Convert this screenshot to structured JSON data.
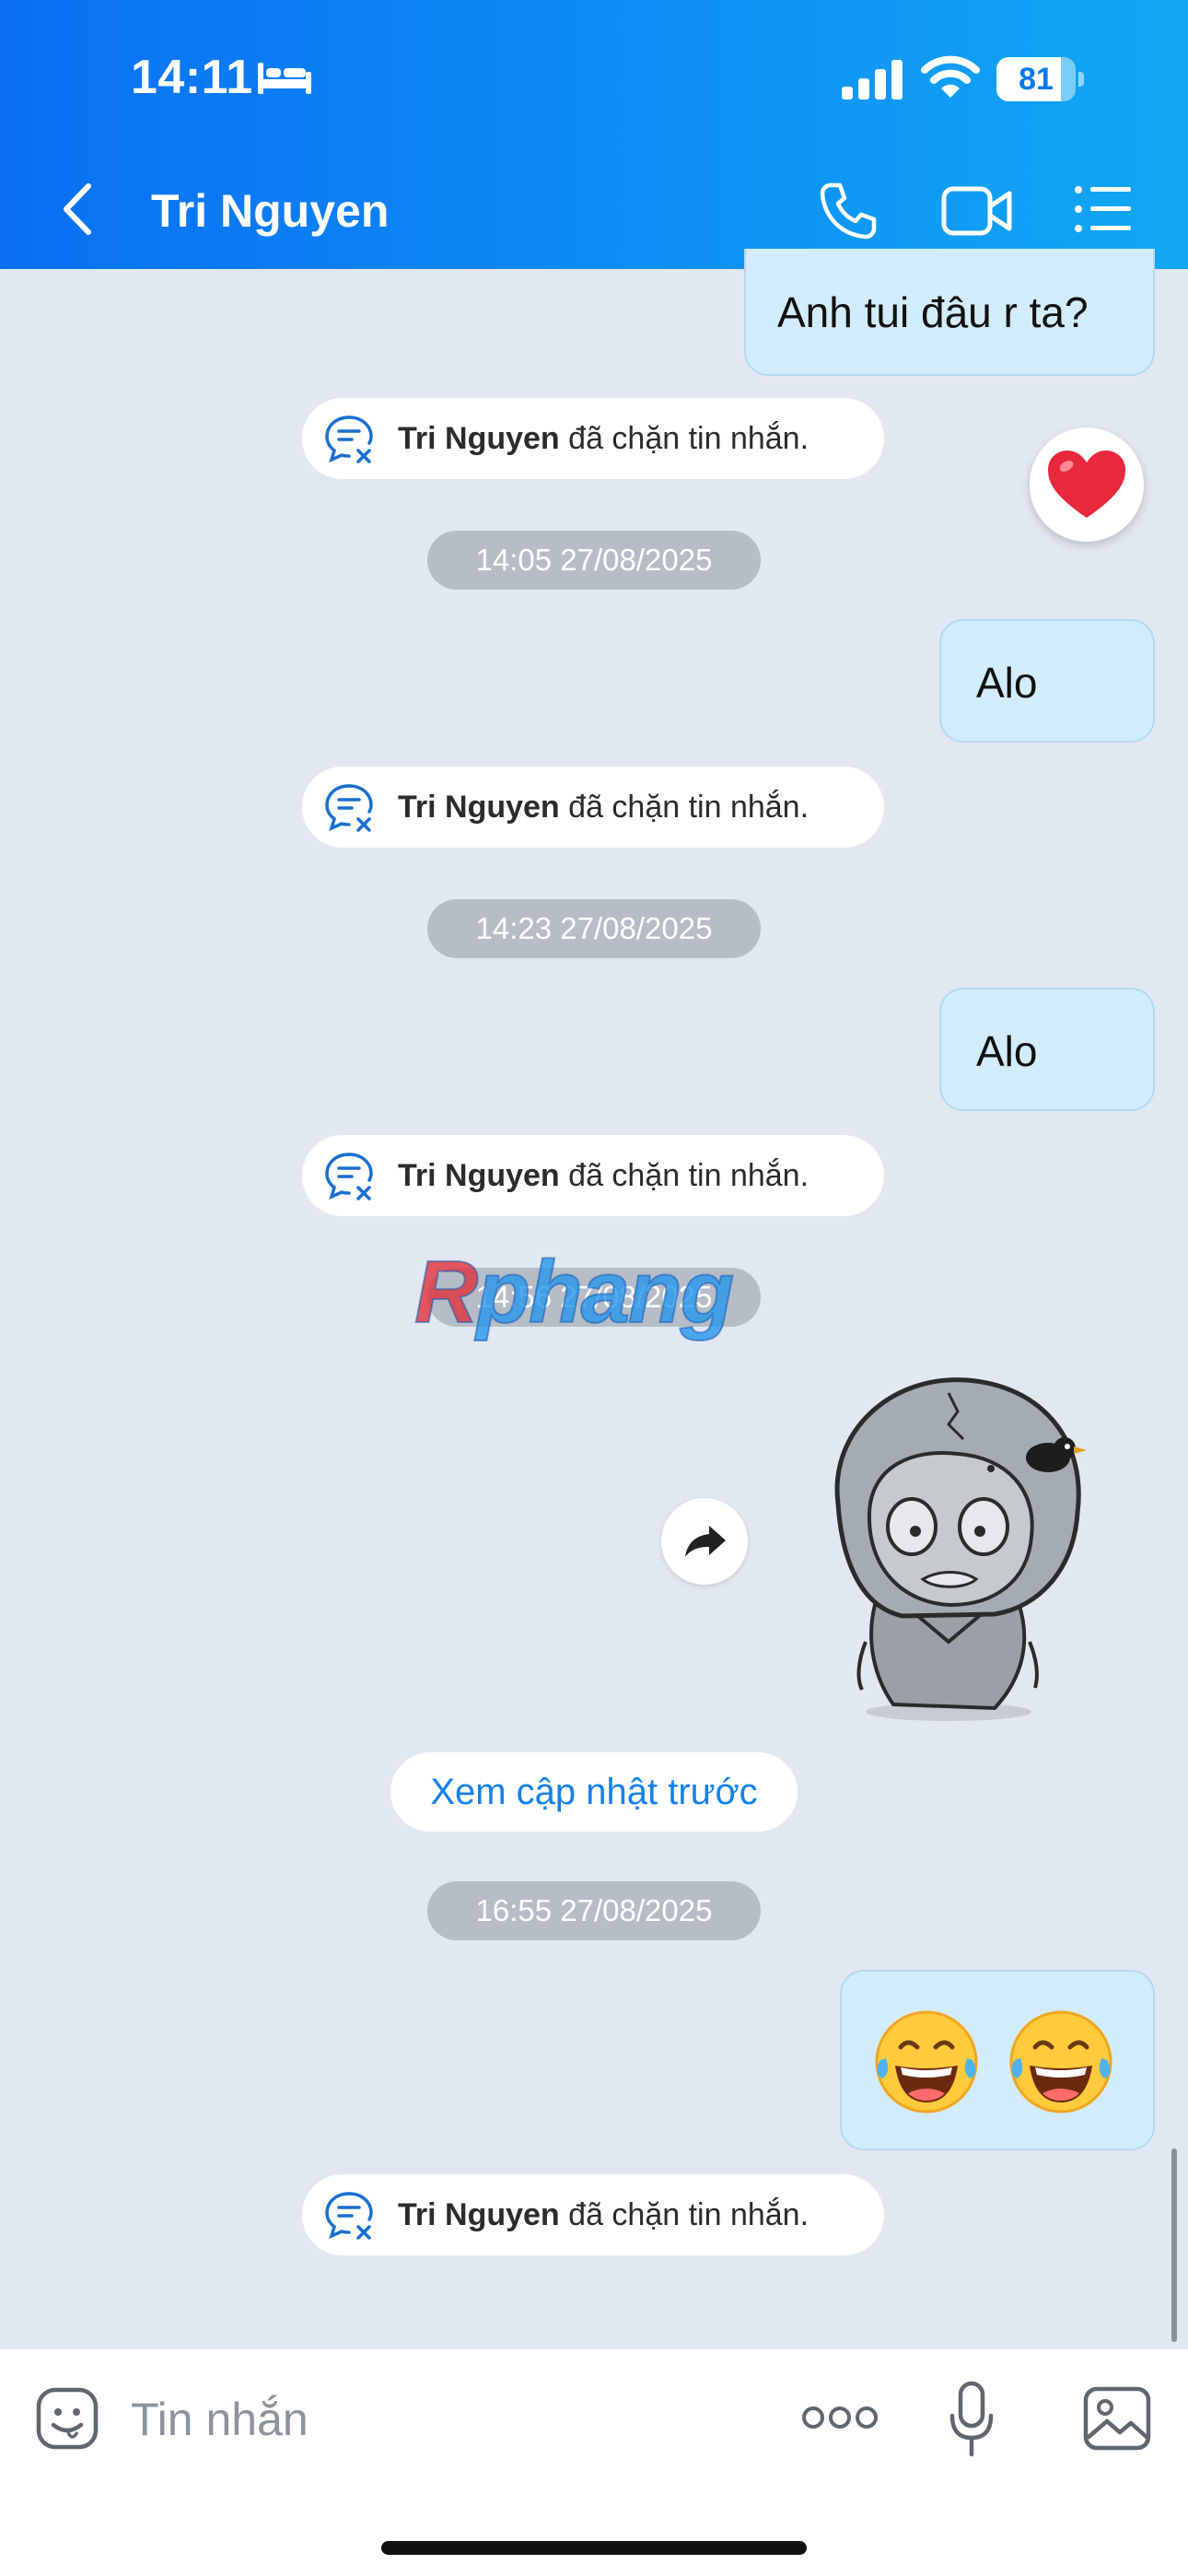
{
  "status_bar": {
    "time": "14:11",
    "battery": "81",
    "battery_fraction": 0.81,
    "icons": [
      "bed-icon",
      "signal-icon",
      "wifi-icon",
      "battery-icon"
    ]
  },
  "header": {
    "title": "Tri Nguyen",
    "icons": [
      "back-icon",
      "phone-icon",
      "video-call-icon",
      "menu-list-icon"
    ]
  },
  "messages": {
    "m1": "Anh tui đâu r ta?",
    "m2": "Alo",
    "m3": "Alo"
  },
  "notice": {
    "name": "Tri Nguyen",
    "text": "đã chặn tin nhắn."
  },
  "timestamps": [
    "14:05 27/08/2025",
    "14:23 27/08/2025",
    "14:56 27/08/2025",
    "16:55 27/08/2025"
  ],
  "watermark": {
    "first": "R",
    "rest": "phang"
  },
  "see_updates": "Xem cập nhật trước",
  "reaction": "heart-icon",
  "emoji_message": [
    "face-with-tears-of-joy",
    "face-with-tears-of-joy"
  ],
  "input": {
    "placeholder": "Tin nhắn"
  },
  "colors": {
    "header_gradient_start": "#0a6ff2",
    "header_gradient_end": "#12a7f3",
    "chat_background": "#e2e8f1",
    "outgoing_bubble": "#d3ecfb",
    "timestamp_pill": "#b6bdc7",
    "link_blue": "#1580e8",
    "heart_red": "#e8283b"
  }
}
